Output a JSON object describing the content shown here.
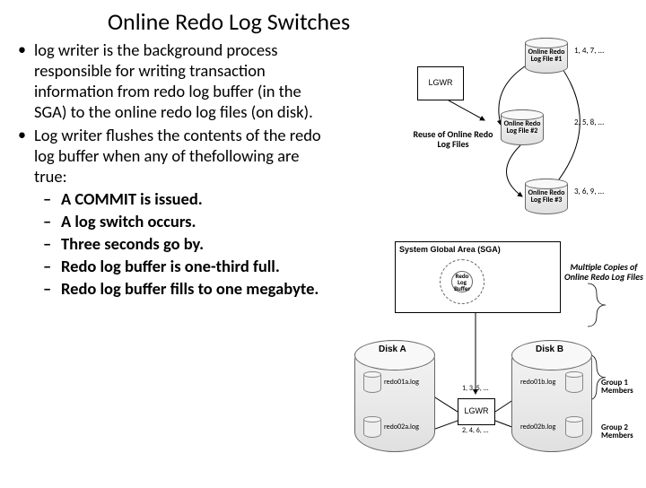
{
  "title": "Online Redo Log Switches",
  "bullets": {
    "b1": "log writer is the background process responsible for writing transaction information from redo log buffer (in the SGA) to the online redo log files (on disk).",
    "b2": "Log writer flushes the contents of the redo log buffer when any of thefollowing are true:",
    "sub": {
      "s1": "A COMMIT is issued.",
      "s2": "A log switch occurs.",
      "s3": "Three seconds go by.",
      "s4": "Redo log buffer is one-third full.",
      "s5": "Redo log buffer fills to one megabyte."
    }
  },
  "diagram": {
    "lgwr_top": "LGWR",
    "reuse_label": "Reuse of Online Redo Log Files",
    "file1": "Online Redo Log File #1",
    "file2": "Online Redo Log File #2",
    "file3": "Online Redo Log File #3",
    "seq1": "1, 4, 7, ...",
    "seq2": "2, 5, 8, ...",
    "seq3": "3, 6, 9, ...",
    "sga": "System Global Area (SGA)",
    "redo_buf": "Redo Log Buffer",
    "diskA": "Disk A",
    "diskB": "Disk B",
    "redo01a": "redo01a.log",
    "redo02a": "redo02a.log",
    "redo01b": "redo01b.log",
    "redo02b": "redo02b.log",
    "lgwr_bottom": "LGWR",
    "seq_a": "1, 3, 5, ...",
    "seq_b": "2, 4, 6, ...",
    "group1": "Group 1 Members",
    "group2": "Group 2 Members",
    "multi_label": "Multiple Copies of Online Redo Log Files"
  }
}
